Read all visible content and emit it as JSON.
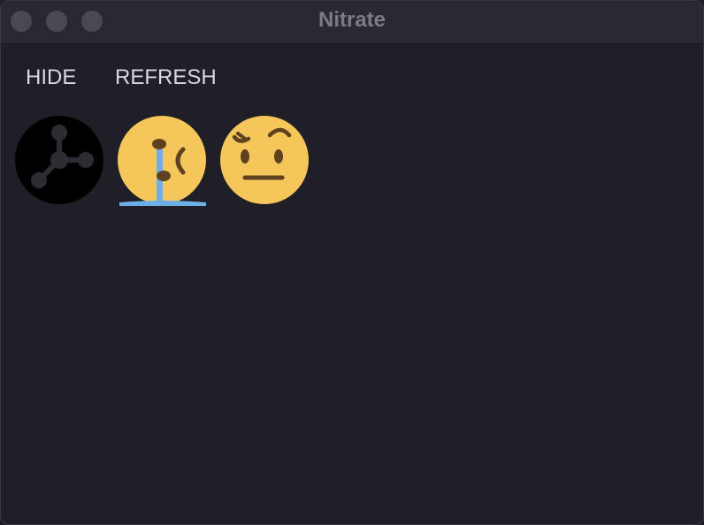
{
  "window": {
    "title": "Nitrate"
  },
  "toolbar": {
    "hide_label": "HIDE",
    "refresh_label": "REFRESH"
  },
  "emoji_list": [
    {
      "icon": "molecule-network-icon"
    },
    {
      "icon": "face-holding-back-tears-melting-icon"
    },
    {
      "icon": "face-with-raised-eyebrow-icon"
    }
  ],
  "colors": {
    "window_bg": "#201e26",
    "titlebar_bg": "#2b2833",
    "title_text": "#7d7a85",
    "button_text": "#dad8de",
    "traffic_light": "#4a4851",
    "emoji_yellow": "#f5c75b",
    "emoji_brown": "#5e4220",
    "tear_blue": "#6db0e8"
  }
}
